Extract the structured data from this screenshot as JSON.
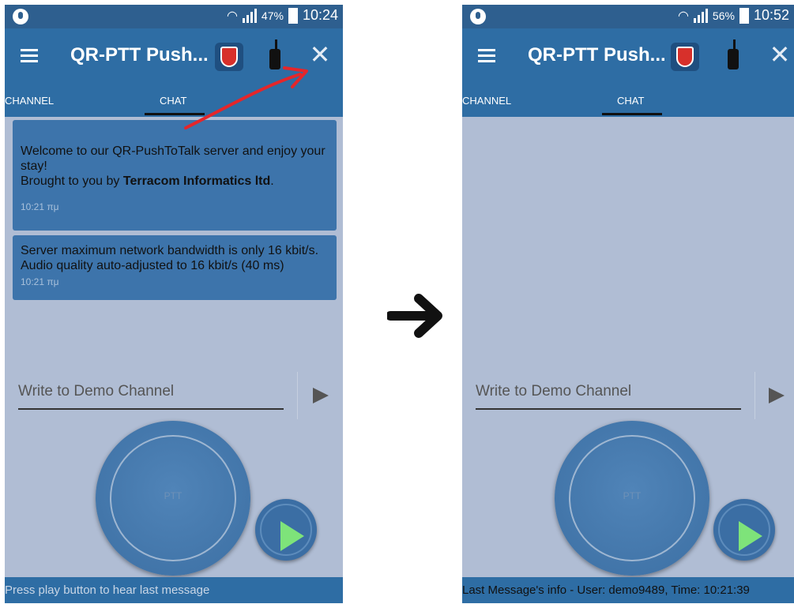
{
  "screens": [
    {
      "status": {
        "battery_pct": "47%",
        "time": "10:24"
      },
      "app_title": "QR-PTT Push...",
      "tabs": [
        "CHANNEL",
        "CHAT"
      ],
      "messages": [
        {
          "line1": "Welcome to our QR-PushToTalk server and enjoy your stay!",
          "line2_prefix": "Brought to you by ",
          "line2_bold": "Terracom Informatics ltd",
          "line2_suffix": ".",
          "time": "10:21 πμ"
        },
        {
          "text": "Server maximum network bandwidth is only 16 kbit/s. Audio quality auto-adjusted to 16 kbit/s (40 ms)",
          "time": "10:21 πμ"
        }
      ],
      "input_placeholder": "Write to Demo Channel",
      "ptt_label": "PTT",
      "bottom_text": "Press play button to hear last message"
    },
    {
      "status": {
        "battery_pct": "56%",
        "time": "10:52"
      },
      "app_title": "QR-PTT Push...",
      "tabs": [
        "CHANNEL",
        "CHAT"
      ],
      "input_placeholder": "Write to Demo Channel",
      "ptt_label": "PTT",
      "bottom_text": "Last Message's info - User: demo9489, Time: 10:21:39"
    }
  ],
  "colors": {
    "app_bar": "#2e6da4",
    "background": "#b0bdd4",
    "message_card": "#3d74ab",
    "play_icon": "#7ee37a",
    "annotation_arrow": "#e5262a"
  },
  "icons": [
    "menu-icon",
    "shield-logo-icon",
    "walkie-talkie-icon",
    "close-icon",
    "send-icon",
    "play-icon",
    "right-arrow-icon"
  ]
}
